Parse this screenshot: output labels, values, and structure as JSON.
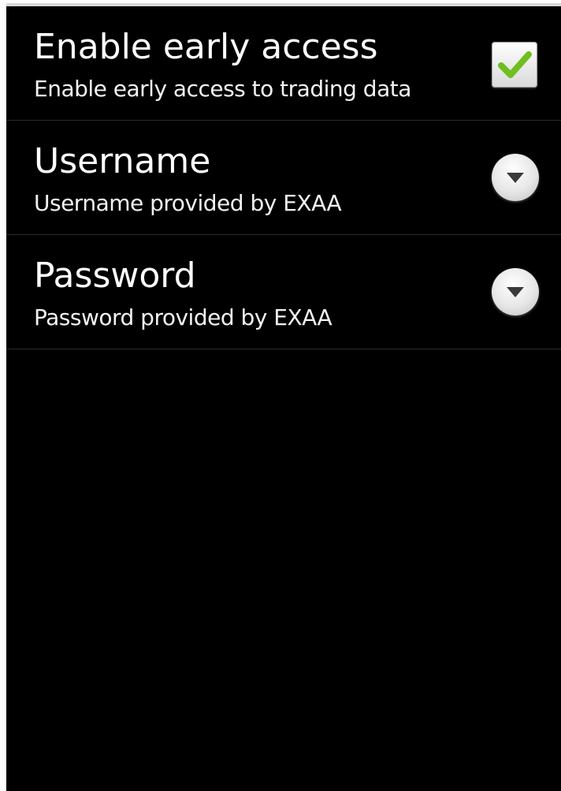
{
  "preferences": [
    {
      "title": "Enable early access",
      "summary": "Enable early access to trading data",
      "widget": "checkbox",
      "checked": true
    },
    {
      "title": "Username",
      "summary": "Username provided by EXAA",
      "widget": "dropdown"
    },
    {
      "title": "Password",
      "summary": "Password provided by EXAA",
      "widget": "dropdown"
    }
  ],
  "colors": {
    "background": "#000000",
    "text": "#ffffff",
    "check": "#6fbf1f",
    "divider": "#2a2a2a"
  },
  "icons": {
    "checkbox": "checkmark-icon",
    "dropdown": "chevron-down-icon"
  }
}
